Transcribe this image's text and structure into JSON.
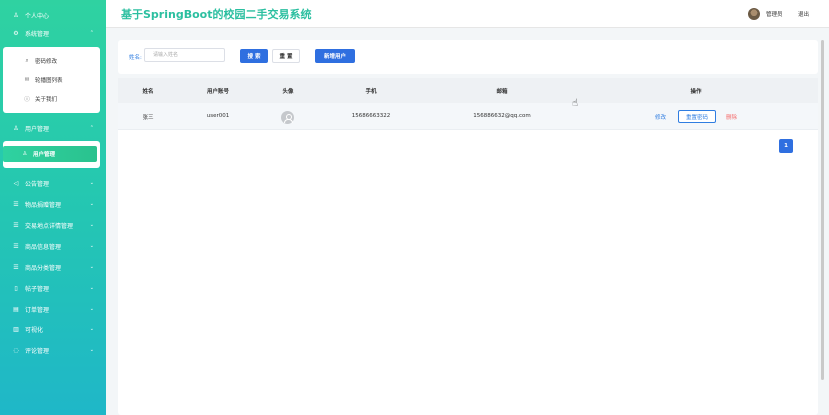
{
  "app": {
    "title": "基于SpringBoot的校园二手交易系统"
  },
  "header": {
    "admin_name": "管理员",
    "logout": "退出"
  },
  "sidebar": {
    "personal_center": "个人中心",
    "system_management": "系统管理",
    "system_items": [
      "密码修改",
      "轮播图列表",
      "关于我们"
    ],
    "user_management": "用户管理",
    "user_items": [
      "用户管理"
    ],
    "other_items": [
      "公告管理",
      "物品捐赠管理",
      "交易地点详情管理",
      "商品信息管理",
      "商品分类管理",
      "帖子管理",
      "订单管理",
      "可视化",
      "评论管理"
    ]
  },
  "search": {
    "name_label": "姓名:",
    "name_placeholder": "请输入姓名",
    "search_button": "搜 索",
    "reset_button": "重 置",
    "add_button": "新增用户"
  },
  "table": {
    "columns": [
      "姓名",
      "用户账号",
      "头像",
      "手机",
      "邮箱",
      "操作"
    ],
    "rows": [
      {
        "name": "张三",
        "account": "user001",
        "phone": "15686663322",
        "email": "156886632@qq.com"
      }
    ],
    "actions": {
      "edit": "修改",
      "reset_password": "重置密码",
      "delete": "删除"
    }
  },
  "pagination": {
    "current_page": "1"
  },
  "colors": {
    "accent": "#2fd2a1",
    "primary": "#2f6fe0",
    "danger": "#f56c6c",
    "title": "#2bbfa0"
  }
}
